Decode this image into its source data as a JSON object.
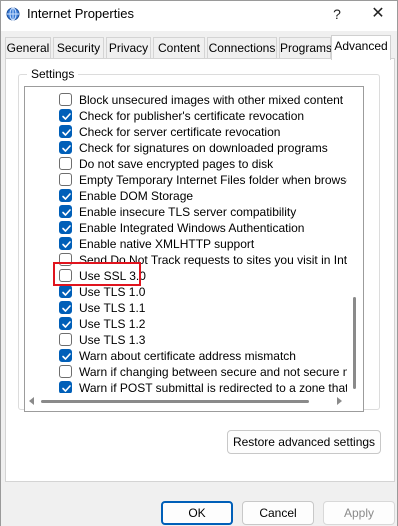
{
  "window": {
    "title": "Internet Properties",
    "help_label": "?",
    "close_label": "✕"
  },
  "tabs": [
    {
      "label": "General",
      "active": false
    },
    {
      "label": "Security",
      "active": false
    },
    {
      "label": "Privacy",
      "active": false
    },
    {
      "label": "Content",
      "active": false
    },
    {
      "label": "Connections",
      "active": false
    },
    {
      "label": "Programs",
      "active": false
    },
    {
      "label": "Advanced",
      "active": true
    }
  ],
  "settings": {
    "group_label": "Settings",
    "items": [
      {
        "label": "Block unsecured images with other mixed content",
        "checked": false
      },
      {
        "label": "Check for publisher's certificate revocation",
        "checked": true
      },
      {
        "label": "Check for server certificate revocation",
        "checked": true
      },
      {
        "label": "Check for signatures on downloaded programs",
        "checked": true
      },
      {
        "label": "Do not save encrypted pages to disk",
        "checked": false
      },
      {
        "label": "Empty Temporary Internet Files folder when browser is clo",
        "checked": false
      },
      {
        "label": "Enable DOM Storage",
        "checked": true
      },
      {
        "label": "Enable insecure TLS server compatibility",
        "checked": true
      },
      {
        "label": "Enable Integrated Windows Authentication",
        "checked": true
      },
      {
        "label": "Enable native XMLHTTP support",
        "checked": true
      },
      {
        "label": "Send Do Not Track requests to sites you visit in Internet E",
        "checked": false
      },
      {
        "label": "Use SSL 3.0",
        "checked": false
      },
      {
        "label": "Use TLS 1.0",
        "checked": true
      },
      {
        "label": "Use TLS 1.1",
        "checked": true
      },
      {
        "label": "Use TLS 1.2",
        "checked": true
      },
      {
        "label": "Use TLS 1.3",
        "checked": false
      },
      {
        "label": "Warn about certificate address mismatch",
        "checked": true
      },
      {
        "label": "Warn if changing between secure and not secure mode",
        "checked": false
      },
      {
        "label": "Warn if POST submittal is redirected to a zone that does n",
        "checked": true
      }
    ]
  },
  "restore_button": "Restore advanced settings",
  "footer": {
    "ok": "OK",
    "cancel": "Cancel",
    "apply": "Apply"
  },
  "colors": {
    "accent": "#005fb8",
    "highlight": "#e0141e"
  }
}
